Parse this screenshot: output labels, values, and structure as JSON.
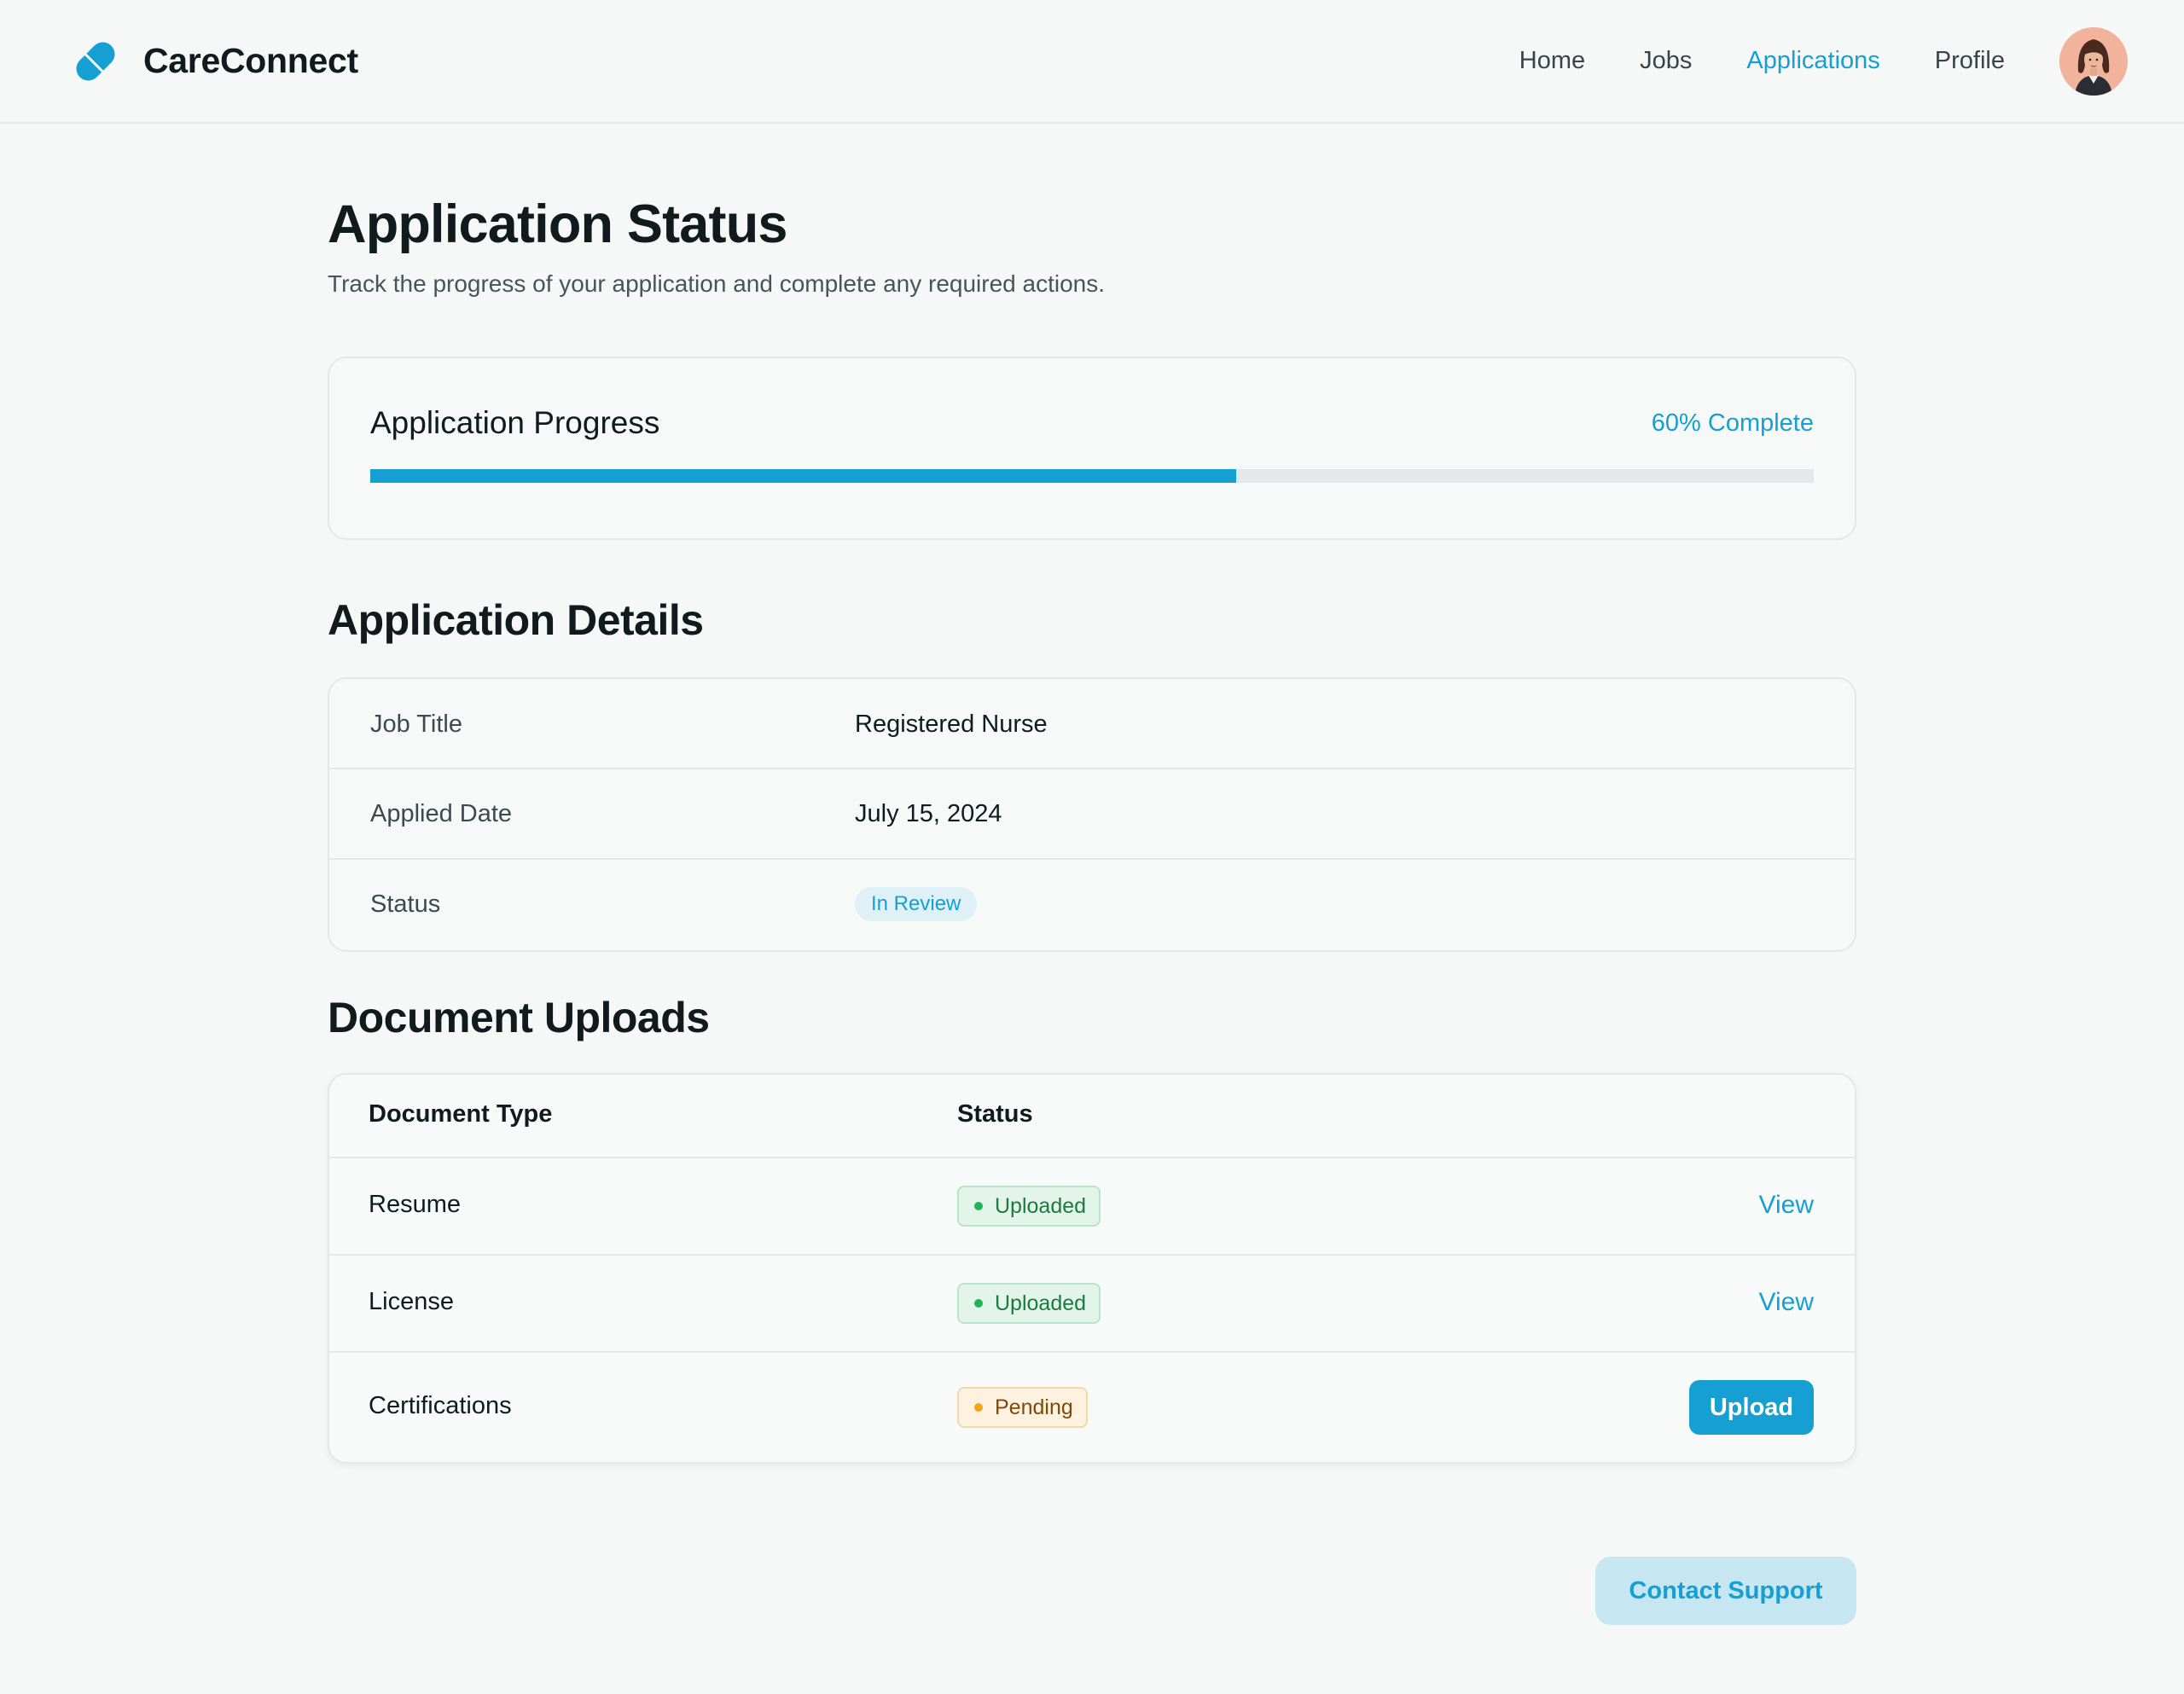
{
  "colors": {
    "accent": "#159fd3",
    "background": "#f6f8f7",
    "success": "#22b357",
    "warning": "#f1a517"
  },
  "header": {
    "logo_icon": "pill-capsule-icon",
    "brand": "CareConnect",
    "nav": [
      {
        "label": "Home",
        "active": false
      },
      {
        "label": "Jobs",
        "active": false
      },
      {
        "label": "Applications",
        "active": true
      },
      {
        "label": "Profile",
        "active": false
      }
    ],
    "avatar_icon": "user-avatar"
  },
  "page": {
    "title": "Application Status",
    "subtitle": "Track the progress of your application and complete any required actions."
  },
  "progress": {
    "title": "Application Progress",
    "label": "60% Complete",
    "percent": 60
  },
  "details": {
    "title": "Application Details",
    "rows": [
      {
        "label": "Job Title",
        "value": "Registered Nurse"
      },
      {
        "label": "Applied Date",
        "value": "July 15, 2024"
      },
      {
        "label": "Status",
        "value": "In Review"
      }
    ]
  },
  "uploads": {
    "title": "Document Uploads",
    "headers": {
      "type": "Document Type",
      "status": "Status"
    },
    "rows": [
      {
        "type": "Resume",
        "status": "Uploaded",
        "action": "View"
      },
      {
        "type": "License",
        "status": "Uploaded",
        "action": "View"
      },
      {
        "type": "Certifications",
        "status": "Pending",
        "action": "Upload"
      }
    ]
  },
  "support": {
    "label": "Contact Support"
  }
}
